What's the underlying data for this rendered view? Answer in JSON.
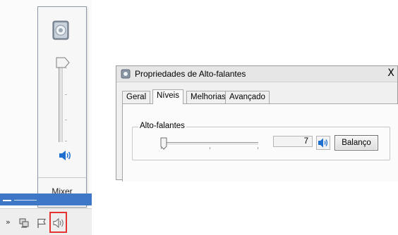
{
  "volume_flyout": {
    "level_percent": 92,
    "mixer_label": "Mixer"
  },
  "taskbar": {
    "tray_expand_glyph": "»",
    "icons": [
      "show-hidden-icons",
      "network-icon",
      "action-center-flag-icon",
      "speaker-volume-icon"
    ]
  },
  "dialog": {
    "title": "Propriedades de Alto-falantes",
    "close_glyph": "X",
    "tabs": [
      {
        "label": "Geral"
      },
      {
        "label": "Níveis"
      },
      {
        "label": "Melhorias"
      },
      {
        "label": "Avançado"
      }
    ],
    "active_tab": "Níveis",
    "levels": {
      "group_label": "Alto-falantes",
      "level_value": "7",
      "balance_button": "Balanço"
    }
  },
  "colors": {
    "taskbar_blue": "#3f77c7",
    "highlight_red": "#e53232",
    "speaker_blue": "#1f6fd1"
  }
}
